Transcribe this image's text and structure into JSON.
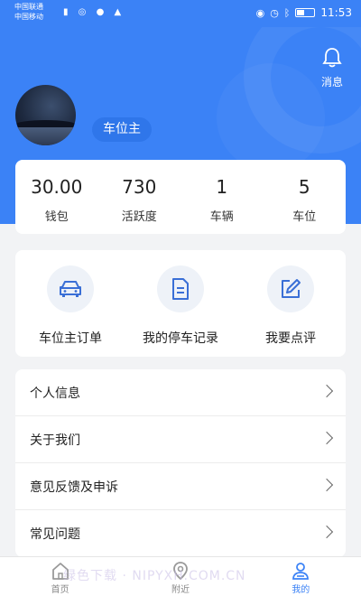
{
  "status_bar": {
    "carrier_1": "中国联通",
    "carrier_2": "中国移动",
    "time": "11:53"
  },
  "header": {
    "message_label": "消息",
    "role_badge": "车位主"
  },
  "stats": [
    {
      "value": "30.00",
      "label": "钱包"
    },
    {
      "value": "730",
      "label": "活跃度"
    },
    {
      "value": "1",
      "label": "车辆"
    },
    {
      "value": "5",
      "label": "车位"
    }
  ],
  "actions": [
    {
      "label": "车位主订单",
      "icon": "car-icon"
    },
    {
      "label": "我的停车记录",
      "icon": "document-icon"
    },
    {
      "label": "我要点评",
      "icon": "edit-icon"
    }
  ],
  "menu": [
    {
      "label": "个人信息"
    },
    {
      "label": "关于我们"
    },
    {
      "label": "意见反馈及申诉"
    },
    {
      "label": "常见问题"
    }
  ],
  "bottom_nav": [
    {
      "label": "首页",
      "icon": "home-icon"
    },
    {
      "label": "附近",
      "icon": "location-icon"
    },
    {
      "label": "我的",
      "icon": "user-icon",
      "active": true
    }
  ],
  "watermark": "绿色下载 · NIPYXH.COM.CN",
  "colors": {
    "primary": "#3b82f6",
    "icon_blue": "#3a6fd6"
  }
}
